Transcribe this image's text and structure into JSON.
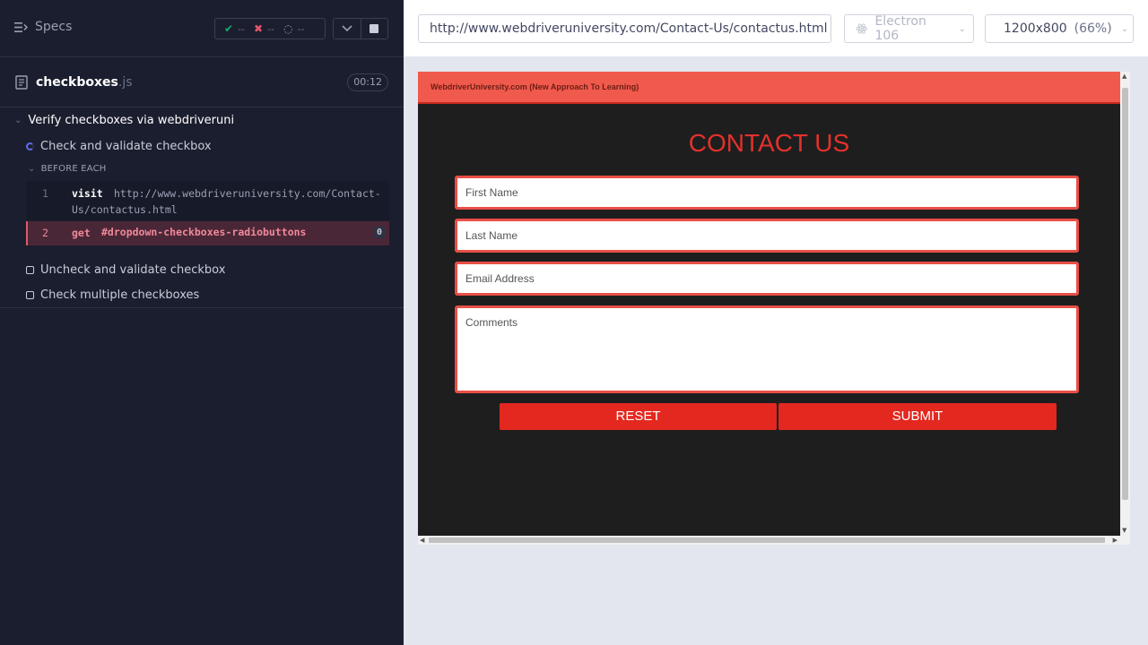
{
  "runner": {
    "specs_label": "Specs",
    "stats": {
      "passed": "--",
      "failed": "--",
      "pending": "--"
    },
    "spec_file": {
      "name": "checkboxes",
      "ext": ".js",
      "duration": "00:12"
    },
    "suite_title": "Verify checkboxes via webdriveruni",
    "tests": [
      {
        "title": "Check and validate checkbox",
        "state": "running"
      },
      {
        "title": "Uncheck and validate checkbox",
        "state": "pending"
      },
      {
        "title": "Check multiple checkboxes",
        "state": "pending"
      }
    ],
    "hook_label": "BEFORE EACH",
    "commands": [
      {
        "num": "1",
        "name": "visit",
        "arg_line1": "http://www.webdriveruniversity.com/Contact-",
        "arg_line2": "Us/contactus.html"
      },
      {
        "num": "2",
        "name": "get",
        "arg": "#dropdown-checkboxes-radiobuttons",
        "count": "0"
      }
    ]
  },
  "browser_bar": {
    "url": "http://www.webdriveruniversity.com/Contact-Us/contactus.html",
    "browser": "Electron 106",
    "viewport": "1200x800",
    "zoom": "(66%)"
  },
  "aut": {
    "header": "WebdriverUniversity.com (New Approach To Learning)",
    "title": "CONTACT US",
    "first_name_placeholder": "First Name",
    "last_name_placeholder": "Last Name",
    "email_placeholder": "Email Address",
    "comments_placeholder": "Comments",
    "reset_label": "RESET",
    "submit_label": "SUBMIT"
  },
  "colors": {
    "runner_bg": "#1b1e2e",
    "pass": "#1fa971",
    "fail": "#e2566b",
    "aut_header": "#f05a4c",
    "aut_accent": "#e3281f"
  }
}
